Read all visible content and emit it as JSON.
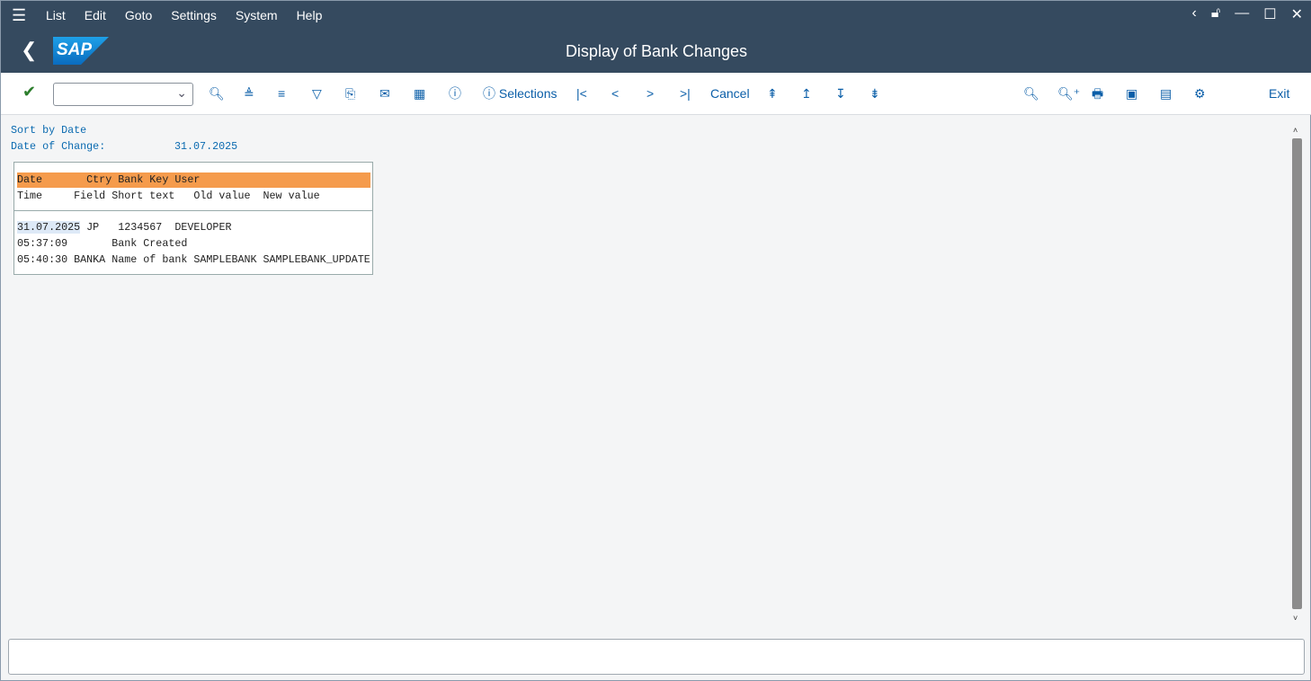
{
  "menu": {
    "items": [
      "List",
      "Edit",
      "Goto",
      "Settings",
      "System",
      "Help"
    ]
  },
  "title": {
    "text": "Display of Bank Changes",
    "logo": "SAP"
  },
  "toolbar": {
    "selections": "Selections",
    "cancel": "Cancel",
    "exit": "Exit",
    "command_value": ""
  },
  "report": {
    "sort_label": "Sort by Date",
    "date_label": "Date of Change:",
    "date_value": "31.07.2025",
    "header1": "Date       Ctry Bank Key User",
    "header2": "Time     Field Short text   Old value  New value",
    "row1": {
      "date": "31.07.2025",
      "rest": " JP   1234567  DEVELOPER"
    },
    "row2": "05:37:09       Bank Created",
    "row3": "05:40:30 BANKA Name of bank SAMPLEBANK SAMPLEBANK_UPDATE"
  },
  "colors": {
    "shell": "#354a5f",
    "header_row": "#f59b4c",
    "highlight": "#f8b98a",
    "link_text": "#0a6ab0"
  }
}
